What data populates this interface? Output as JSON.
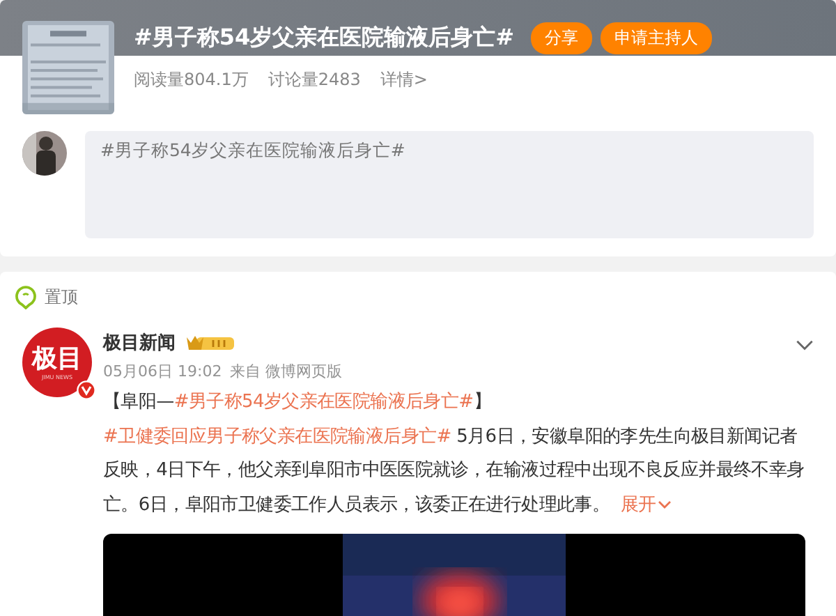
{
  "topic": {
    "title": "#男子称54岁父亲在医院输液后身亡#",
    "buttons": [
      "分享",
      "申请主持人"
    ],
    "stats": [
      "阅读量804.1万",
      "讨论量2483"
    ],
    "details_link": "详情>"
  },
  "composer": {
    "value": "#男子称54岁父亲在医院输液后身亡#"
  },
  "pinned": {
    "label": "置顶"
  },
  "post": {
    "logo_text": "极目",
    "logo_subtext": "JIMU NEWS",
    "author": "极目新闻",
    "time": "05月06日 19:02",
    "source": "来自 微博网页版",
    "body": [
      {
        "kind": "text",
        "text": "【阜阳—"
      },
      {
        "kind": "topic",
        "text": "#男子称54岁父亲在医院输液后身亡#"
      },
      {
        "kind": "text",
        "text": "】"
      },
      {
        "kind": "topic",
        "text": "#卫健委回应男子称父亲在医院输液后身亡#"
      },
      {
        "kind": "text",
        "text": " 5月6日，安徽阜阳的李先生向极目新闻记者反映，4日下午，他父亲到阜阳市中医医院就诊，在输液过程中出现不良反应并最终不幸身亡。6日，阜阳市卫健委工作人员表示，该委正在进行处理此事。 "
      }
    ],
    "expand": "展开"
  }
}
